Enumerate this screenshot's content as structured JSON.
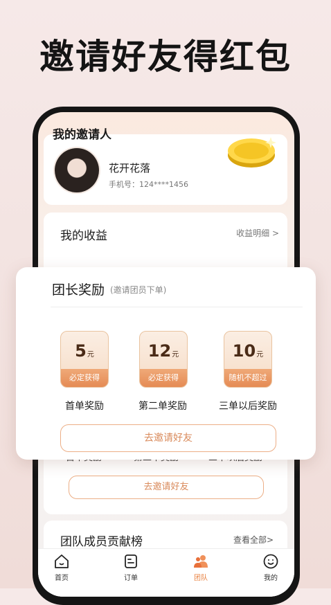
{
  "promo": {
    "title": "邀请好友得红包"
  },
  "inviter": {
    "section_title": "我的邀请人",
    "name": "花开花落",
    "phone": "手机号：124****1456"
  },
  "earnings": {
    "title": "我的收益",
    "detail_link": "收益明细 >",
    "ghost_labels": [
      "首单奖励",
      "第二单奖励",
      "三单以后奖励"
    ],
    "invite_button": "去邀请好友"
  },
  "leader_rewards": {
    "title": "团长奖励",
    "subtitle": "(邀请团员下单)",
    "items": [
      {
        "amount": "5",
        "unit": "元",
        "tag": "必定获得",
        "label": "首单奖励"
      },
      {
        "amount": "12",
        "unit": "元",
        "tag": "必定获得",
        "label": "第二单奖励"
      },
      {
        "amount": "10",
        "unit": "元",
        "tag": "随机不超过",
        "label": "三单以后奖励"
      }
    ],
    "invite_button": "去邀请好友"
  },
  "ranking": {
    "title": "团队成员贡献榜",
    "view_all": "查看全部>"
  },
  "tabbar": {
    "active_color": "#e8803f",
    "tabs": [
      {
        "label": "首页",
        "icon": "home-icon"
      },
      {
        "label": "订单",
        "icon": "order-icon"
      },
      {
        "label": "团队",
        "icon": "team-icon"
      },
      {
        "label": "我的",
        "icon": "profile-icon"
      }
    ]
  }
}
